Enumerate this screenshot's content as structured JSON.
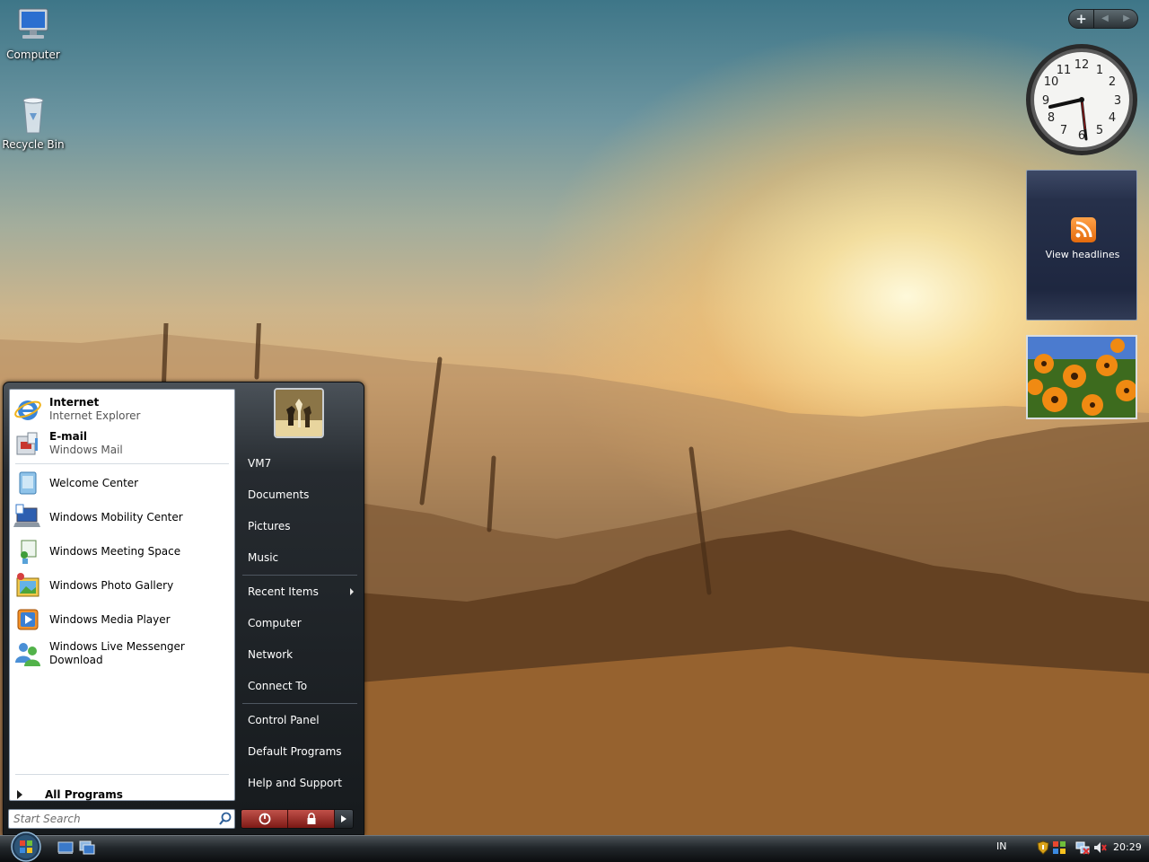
{
  "desktop": {
    "icons": [
      {
        "label": "Computer"
      },
      {
        "label": "Recycle Bin"
      }
    ]
  },
  "gadgets": {
    "add_label": "+",
    "feed_label": "View headlines",
    "clock_numbers": [
      "12",
      "1",
      "2",
      "3",
      "4",
      "5",
      "6",
      "7",
      "8",
      "9",
      "10",
      "11"
    ]
  },
  "start_menu": {
    "pinned": [
      {
        "name": "Internet",
        "sub": "Internet Explorer",
        "icon": "internet-explorer-icon"
      },
      {
        "name": "E-mail",
        "sub": "Windows Mail",
        "icon": "windows-mail-icon"
      }
    ],
    "recent": [
      {
        "name": "Welcome Center",
        "icon": "welcome-center-icon"
      },
      {
        "name": "Windows Mobility Center",
        "icon": "mobility-center-icon"
      },
      {
        "name": "Windows Meeting Space",
        "icon": "meeting-space-icon"
      },
      {
        "name": "Windows Photo Gallery",
        "icon": "photo-gallery-icon"
      },
      {
        "name": "Windows Media Player",
        "icon": "media-player-icon"
      },
      {
        "name": "Windows Live Messenger Download",
        "icon": "messenger-icon"
      }
    ],
    "all_programs": "All Programs",
    "search_placeholder": "Start Search",
    "right": {
      "user": "VM7",
      "documents": "Documents",
      "pictures": "Pictures",
      "music": "Music",
      "recent_items": "Recent Items",
      "computer": "Computer",
      "network": "Network",
      "connect_to": "Connect To",
      "control_panel": "Control Panel",
      "default_programs": "Default Programs",
      "help_support": "Help and Support"
    }
  },
  "taskbar": {
    "language": "IN",
    "time": "20:29"
  }
}
